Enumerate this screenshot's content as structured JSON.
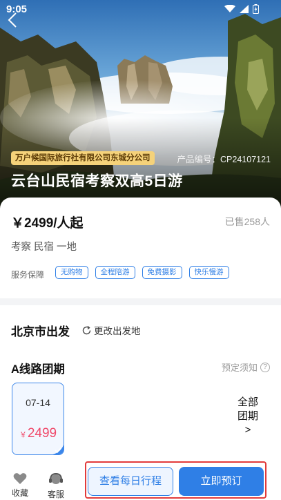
{
  "status_bar": {
    "time": "9:05"
  },
  "hero": {
    "company": "万户候国际旅行社有限公司东城分公司",
    "product_code": "产品编号：CP24107121",
    "title": "云台山民宿考察双高5日游"
  },
  "info": {
    "price": "￥2499/人起",
    "sold": "已售258人",
    "tags": "考察 民宿 一地",
    "service_label": "服务保障",
    "service_chips": [
      "无购物",
      "全程陪游",
      "免费摄影",
      "快乐慢游"
    ]
  },
  "departure": {
    "city": "北京市出发",
    "change_label": "更改出发地"
  },
  "route": {
    "title": "A线路团期",
    "notice": "预定须知",
    "notice_icon": "?",
    "dates": [
      {
        "date": "07-14",
        "currency": "￥",
        "price": "2499",
        "selected": true
      }
    ],
    "all_groups_line1": "全部",
    "all_groups_line2": "团期",
    "all_groups_arrow": ">"
  },
  "bottom": {
    "favorite": "收藏",
    "service": "客服",
    "itinerary_button": "查看每日行程",
    "book_button": "立即预订"
  },
  "colors": {
    "accent": "#2f7fe6",
    "price_pink": "#f0496a",
    "badge_gold": "#f5d27a",
    "highlight_red": "#e23a3a"
  }
}
